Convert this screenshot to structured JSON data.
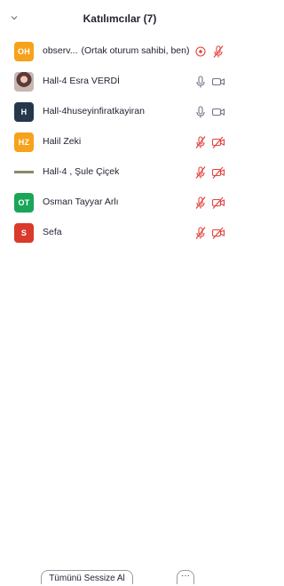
{
  "panel": {
    "title": "Katılımcılar (7)",
    "collapse_icon": "chevron-down-icon"
  },
  "participants": [
    {
      "initials": "OH",
      "avatar_color": "#f7a21b",
      "avatar_type": "initials",
      "name": "observ...",
      "suffix": "(Ortak oturum sahibi, ben)",
      "icons": [
        "recording-icon",
        "mic-muted-icon"
      ]
    },
    {
      "initials": "",
      "avatar_color": "#8a5a5a",
      "avatar_type": "photo",
      "name": "Hall-4 Esra VERDİ",
      "suffix": "",
      "icons": [
        "mic-icon",
        "video-icon"
      ]
    },
    {
      "initials": "H",
      "avatar_color": "#26364d",
      "avatar_type": "initials",
      "name": "Hall-4huseyinfiratkayiran",
      "suffix": "",
      "icons": [
        "mic-icon",
        "video-icon"
      ]
    },
    {
      "initials": "HZ",
      "avatar_color": "#f7a21b",
      "avatar_type": "initials",
      "name": "Halil Zeki",
      "suffix": "",
      "icons": [
        "mic-muted-icon",
        "video-off-icon"
      ]
    },
    {
      "initials": "",
      "avatar_color": "#8a8a6a",
      "avatar_type": "image",
      "name": "Hall-4 , Şule Çiçek",
      "suffix": "",
      "icons": [
        "mic-muted-icon",
        "video-off-icon"
      ]
    },
    {
      "initials": "OT",
      "avatar_color": "#1aa657",
      "avatar_type": "initials",
      "name": "Osman Tayyar Arlı",
      "suffix": "",
      "icons": [
        "mic-muted-icon",
        "video-off-icon"
      ]
    },
    {
      "initials": "S",
      "avatar_color": "#d93a2b",
      "avatar_type": "initials",
      "name": "Sefa",
      "suffix": "",
      "icons": [
        "mic-muted-icon",
        "video-off-icon"
      ]
    }
  ],
  "footer": {
    "mute_all_label": "Tümünü Sessize Al",
    "more_label": "···"
  },
  "colors": {
    "muted": "#e0443e",
    "icon_gray": "#747487",
    "accent": "#f7a21b"
  }
}
